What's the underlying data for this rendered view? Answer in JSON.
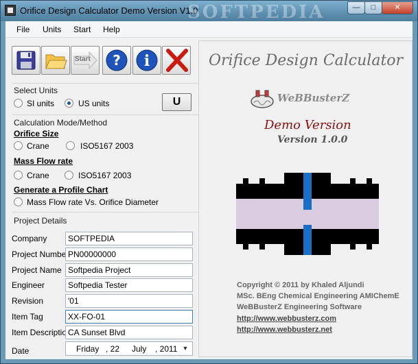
{
  "window": {
    "title": "Orifice Design Calculator Demo Version V1.0",
    "watermark": "SOFTPEDIA",
    "controls": {
      "minimize": "—",
      "maximize": "□",
      "close": "✕"
    }
  },
  "menu": [
    {
      "label": "File"
    },
    {
      "label": "Units"
    },
    {
      "label": "Start"
    },
    {
      "label": "Help"
    }
  ],
  "toolbar": {
    "start_label": "Start"
  },
  "select_units": {
    "heading": "Select Units",
    "options": [
      {
        "label": "SI units",
        "checked": false
      },
      {
        "label": "US units",
        "checked": true
      }
    ],
    "u_button": "U"
  },
  "calc_mode": {
    "heading": "Calculation Mode/Method",
    "orifice_size": {
      "title": "Orifice Size",
      "options": [
        {
          "label": "Crane"
        },
        {
          "label": "ISO5167 2003"
        }
      ]
    },
    "mass_flow": {
      "title": "Mass Flow rate",
      "options": [
        {
          "label": "Crane"
        },
        {
          "label": "ISO5167 2003"
        }
      ]
    },
    "profile_chart": {
      "title": "Generate a Profile Chart",
      "option": "Mass Flow rate Vs. Orifice Diameter"
    }
  },
  "project_details": {
    "heading": "Project Details",
    "fields": [
      {
        "label": "Company",
        "value": "SOFTPEDIA"
      },
      {
        "label": "Project Number",
        "value": "PN00000000"
      },
      {
        "label": "Project Name",
        "value": "Softpedia Project"
      },
      {
        "label": "Engineer",
        "value": "Softpedia Tester"
      },
      {
        "label": "Revision",
        "value": "'01"
      },
      {
        "label": "Item Tag",
        "value": "XX-FO-01"
      },
      {
        "label": "Item Description",
        "value": "CA Sunset Blvd"
      }
    ],
    "date": {
      "label": "Date",
      "weekday": "Friday",
      "day": ", 22",
      "month": "July",
      "year": ", 2011"
    }
  },
  "about": {
    "app_title": "Orifice Design Calculator",
    "brand": "WeBBusterZ",
    "demo": "Demo Version",
    "version": "Version 1.0.0",
    "copyright": "Copyright © 2011 by Khaled Aljundi",
    "degree": "MSc. BEng Chemical Engineering AMIChemE",
    "company": "WeBBusterZ Engineering Software",
    "link1": "http://www.webbusterz.com",
    "link2": "http://www.webbusterz.net"
  },
  "colors": {
    "accent_blue": "#1a6fc4",
    "pipe_fill": "#d9cce0",
    "demo_red": "#8a1010"
  }
}
